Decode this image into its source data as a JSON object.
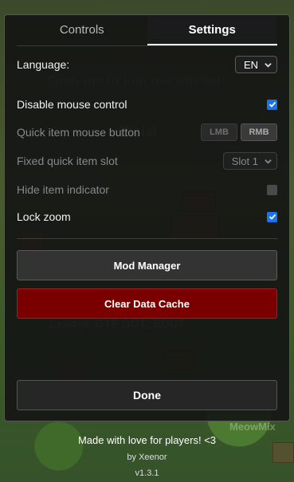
{
  "tabs": [
    {
      "label": "Controls",
      "active": false
    },
    {
      "label": "Settings",
      "active": true
    }
  ],
  "settings": {
    "language": {
      "label": "Language:",
      "value": "EN"
    },
    "disable_mouse": {
      "label": "Disable mouse control",
      "checked": true
    },
    "quick_item_button": {
      "label": "Quick item mouse button",
      "options": [
        "LMB",
        "RMB"
      ],
      "selected": "RMB",
      "enabled": false
    },
    "fixed_slot": {
      "label": "Fixed quick item slot",
      "value": "Slot 1",
      "enabled": false
    },
    "hide_indicator": {
      "label": "Hide item indicator",
      "checked": false,
      "enabled": false
    },
    "lock_zoom": {
      "label": "Lock zoom",
      "checked": true
    }
  },
  "buttons": {
    "mod_manager": "Mod Manager",
    "clear_cache": "Clear Data Cache",
    "done": "Done"
  },
  "footer": {
    "tagline": "Made with love for players! <3",
    "author": "by Xeenor",
    "version": "v1.3.1"
  },
  "colors": {
    "accent": "#1a73e8",
    "danger": "#7a0000"
  }
}
